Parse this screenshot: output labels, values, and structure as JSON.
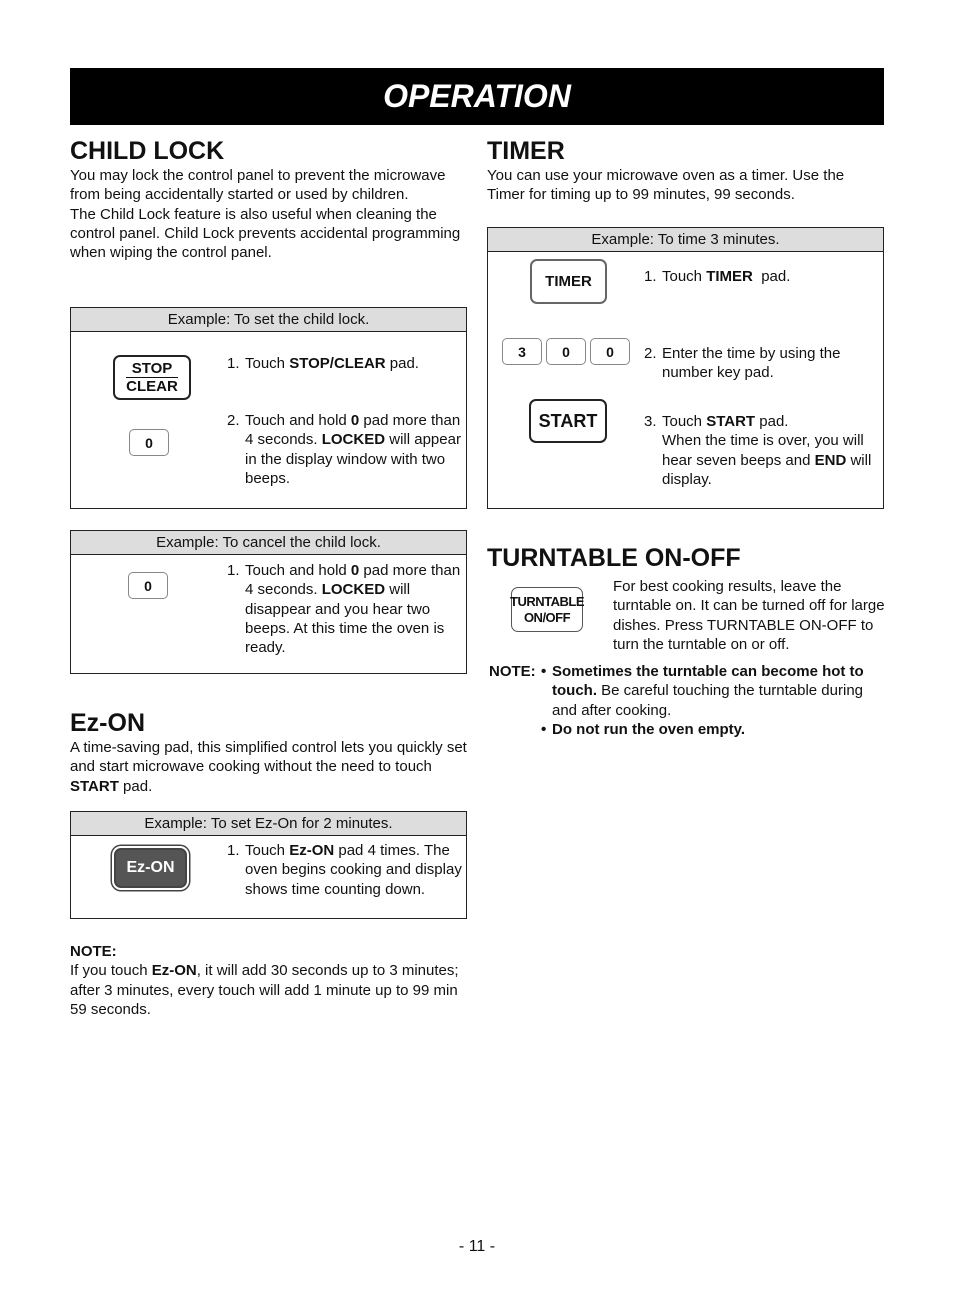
{
  "page_title": "OPERATION",
  "child_lock": {
    "heading": "CHILD LOCK",
    "intro_1": "You may lock the control panel to prevent the microwave from being accidentally started or used by children.",
    "intro_2": "The Child Lock feature is also useful when cleaning the control panel. Child Lock prevents accidental programming when wiping the control panel.",
    "set_example": {
      "title": "Example: To set the child lock.",
      "pads": [
        "STOP",
        "CLEAR",
        "0"
      ],
      "steps": [
        {
          "num": "1.",
          "pre": "Touch ",
          "bold": "STOP/CLEAR",
          "post": " pad."
        },
        {
          "num": "2.",
          "pre": "Touch and hold ",
          "bold": "0",
          "mid": " pad more than 4 seconds. ",
          "bold2": "LOCKED",
          "post": " will appear in the display window with two beeps."
        }
      ]
    },
    "cancel_example": {
      "title": "Example: To cancel the child lock.",
      "pads": [
        "0"
      ],
      "steps": [
        {
          "num": "1.",
          "pre": "Touch and hold ",
          "bold": "0",
          "mid": " pad more than 4 seconds. ",
          "bold2": "LOCKED",
          "post": " will disappear and you hear two beeps. At this time the oven is ready."
        }
      ]
    }
  },
  "ez_on": {
    "heading": "Ez-ON",
    "intro_pre": "A time-saving pad, this simplified control lets you quickly set and start microwave cooking without the need to touch ",
    "intro_bold": "START",
    "intro_post": " pad.",
    "example": {
      "title": "Example: To set Ez-On for 2 minutes.",
      "pad": "Ez-ON",
      "steps": [
        {
          "num": "1.",
          "pre": "Touch ",
          "bold": "Ez-ON",
          "post": " pad 4 times. The oven begins cooking and display shows time counting down."
        }
      ]
    },
    "note_label": "NOTE:",
    "note_pre": "If you touch ",
    "note_bold": "Ez-ON",
    "note_post": ", it will add 30 seconds up to 3 minutes; after 3 minutes, every touch will add 1 minute up to 99 min 59 seconds."
  },
  "timer": {
    "heading": "TIMER",
    "intro": "You can use your microwave oven as a timer. Use the Timer for timing up to 99 minutes, 99 seconds.",
    "example": {
      "title": "Example: To time  3 minutes.",
      "pads": {
        "timer": "TIMER",
        "digits": [
          "3",
          "0",
          "0"
        ],
        "start": "START"
      },
      "steps": [
        {
          "num": "1.",
          "pre": "Touch ",
          "bold": "TIMER",
          "post": "  pad."
        },
        {
          "num": "2.",
          "pre": "Enter the time by using the number key pad.",
          "bold": "",
          "post": ""
        },
        {
          "num": "3.",
          "pre": "Touch ",
          "bold": "START",
          "post": " pad.",
          "line2_pre": "When the time is over, you will hear seven beeps and ",
          "line2_bold": "END",
          "line2_post": " will display."
        }
      ]
    }
  },
  "turntable": {
    "heading": "TURNTABLE ON-OFF",
    "pad_line1": "TURNTABLE",
    "pad_line2": "ON/OFF",
    "description": "For best cooking results, leave the turntable on. It can be turned off for large dishes. Press TURNTABLE ON-OFF to turn the turntable on or off.",
    "note_label": "NOTE:",
    "note_1_bold": "Sometimes the turntable can become hot to touch.",
    "note_1_rest": " Be careful touching the turntable during and after cooking.",
    "note_2_bold": "Do not run the oven empty."
  },
  "page_number": "- 11 -"
}
